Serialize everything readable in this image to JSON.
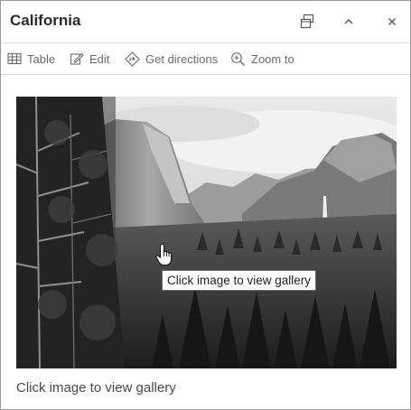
{
  "header": {
    "title": "California",
    "buttons": {
      "dock": "dock-icon",
      "collapse": "chevron-up-icon",
      "close": "close-icon"
    }
  },
  "toolbar": {
    "items": [
      {
        "label": "Table",
        "icon": "table-icon"
      },
      {
        "label": "Edit",
        "icon": "pencil-icon"
      },
      {
        "label": "Get directions",
        "icon": "directions-icon"
      },
      {
        "label": "Zoom to",
        "icon": "zoom-in-icon"
      }
    ]
  },
  "media": {
    "caption": "Click image to view gallery",
    "tooltip": "Click image to view gallery"
  },
  "colors": {
    "border": "#9a9a9a",
    "divider": "#dcdcdc",
    "toolbar_text": "#6a6a6a",
    "title_text": "#2b2b2b"
  }
}
